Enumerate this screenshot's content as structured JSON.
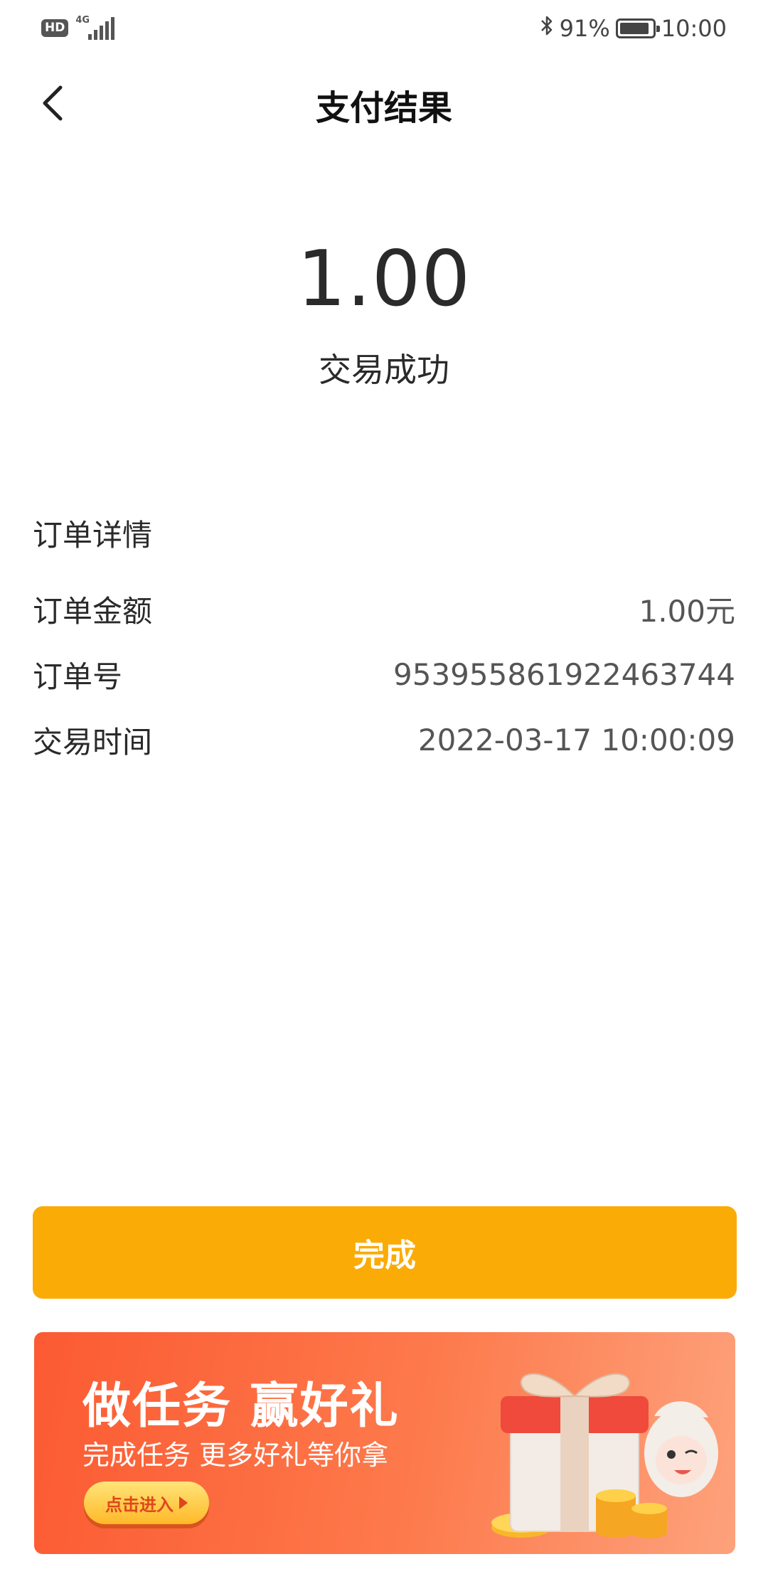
{
  "status_bar": {
    "hd": "HD",
    "network": "4G",
    "battery_text": "91%",
    "battery_level": 0.91,
    "time": "10:00"
  },
  "header": {
    "title": "支付结果"
  },
  "payment": {
    "amount": "1.00",
    "status": "交易成功"
  },
  "details": {
    "heading": "订单详情",
    "rows": [
      {
        "label": "订单金额",
        "value": "1.00元"
      },
      {
        "label": "订单号",
        "value": "953955861922463744"
      },
      {
        "label": "交易时间",
        "value": "2022-03-17 10:00:09"
      }
    ]
  },
  "done_button": {
    "label": "完成"
  },
  "banner": {
    "title": "做任务 赢好礼",
    "subtitle": "完成任务 更多好礼等你拿",
    "cta": "点击进入"
  },
  "colors": {
    "accent": "#fbab05",
    "banner_start": "#fc5a32",
    "banner_end": "#fda27c"
  }
}
